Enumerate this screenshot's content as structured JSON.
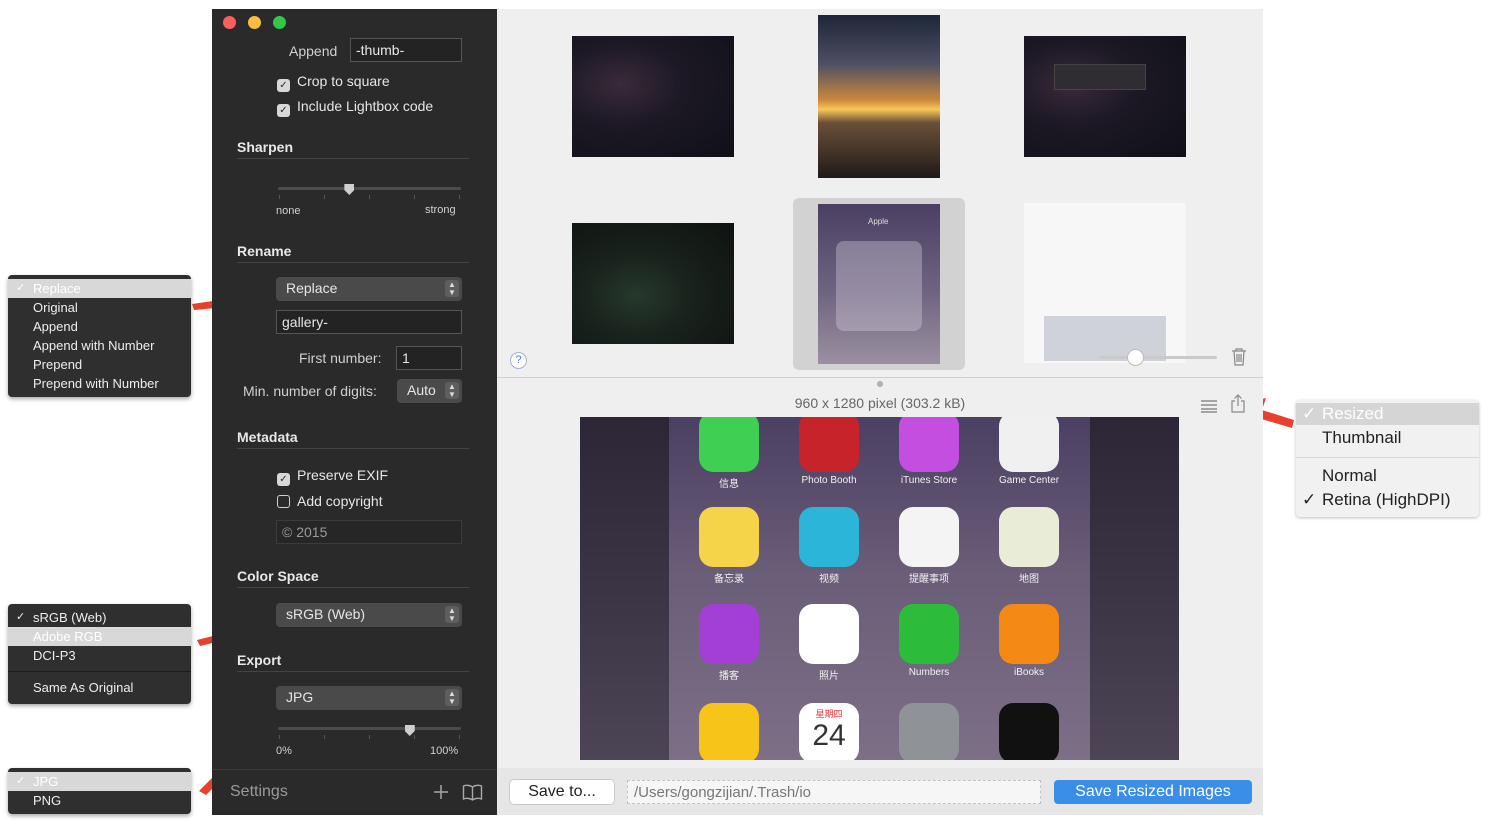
{
  "rename_menu": {
    "items": [
      "Replace",
      "Original",
      "Append",
      "Append with Number",
      "Prepend",
      "Prepend with Number"
    ],
    "selected": "Replace"
  },
  "colorspace_menu": {
    "items": [
      "sRGB (Web)",
      "Adobe RGB",
      "DCI-P3"
    ],
    "extra_item": "Same As Original",
    "checked": "sRGB (Web)",
    "highlighted": "Adobe RGB"
  },
  "format_menu": {
    "items": [
      "JPG",
      "PNG"
    ],
    "checked": "JPG"
  },
  "sidebar": {
    "append_label": "Append",
    "append_value": "-thumb-",
    "crop_label": "Crop to square",
    "crop_checked": true,
    "lightbox_label": "Include Lightbox code",
    "lightbox_checked": true,
    "sharpen_title": "Sharpen",
    "sharpen_min": "none",
    "sharpen_max": "strong",
    "sharpen_level": 0.39,
    "rename_title": "Rename",
    "rename_mode": "Replace",
    "rename_value": "gallery-",
    "first_number_label": "First number:",
    "first_number_value": "1",
    "min_digits_label": "Min. number of digits:",
    "min_digits_value": "Auto",
    "metadata_title": "Metadata",
    "preserve_exif_label": "Preserve EXIF",
    "preserve_exif_checked": true,
    "copyright_label": "Add copyright",
    "copyright_checked": false,
    "copyright_value": "© 2015",
    "colorspace_title": "Color Space",
    "colorspace_value": "sRGB (Web)",
    "export_title": "Export",
    "export_format": "JPG",
    "quality_min": "0%",
    "quality_max": "100%",
    "quality_level": 0.72,
    "settings_label": "Settings",
    "add_icon": "plus-icon",
    "book_icon": "book-icon"
  },
  "content": {
    "help_label": "?",
    "image_info": "960 x 1280 pixel (303.2 kB)",
    "thumb_size_level": 0.3,
    "save_to_label": "Save to...",
    "path_value": "/Users/gongzijian/.Trash/io",
    "save_resized_label": "Save Resized Images",
    "thumb_watermark": "Apple",
    "apps": [
      {
        "name": "信息",
        "color": "#3fcf52"
      },
      {
        "name": "Photo Booth",
        "color": "#c6232b"
      },
      {
        "name": "iTunes Store",
        "color": "#c44ee0"
      },
      {
        "name": "Game Center",
        "color": "#f0f0f0"
      },
      {
        "name": "备忘录",
        "color": "#f6d44a"
      },
      {
        "name": "视频",
        "color": "#2bb6d9"
      },
      {
        "name": "提醒事项",
        "color": "#f4f4f4"
      },
      {
        "name": "地图",
        "color": "#e9ecd6"
      },
      {
        "name": "播客",
        "color": "#a43fd6"
      },
      {
        "name": "照片",
        "color": "#ffffff"
      },
      {
        "name": "Numbers",
        "color": "#2dbb3a"
      },
      {
        "name": "iBooks",
        "color": "#f48a13"
      },
      {
        "name": "",
        "color": "#f7c41a"
      },
      {
        "name": "",
        "color": "#ffffff"
      },
      {
        "name": "",
        "color": "#8f9297"
      },
      {
        "name": "",
        "color": "#111111"
      }
    ],
    "calendar_weekday": "星期四",
    "calendar_day": "24"
  },
  "output_menu": {
    "items": [
      "Resized",
      "Thumbnail"
    ],
    "selected": "Resized",
    "res_items": [
      "Normal",
      "Retina (HighDPI)"
    ],
    "res_checked": "Retina (HighDPI)"
  },
  "colors": {
    "sidebar_bg": "#2a2a2a",
    "accent_blue": "#3a8ee8",
    "arrow_red": "#e8402a",
    "close": "#fc605c",
    "minimize": "#fdbc40",
    "zoom": "#34c84a"
  }
}
